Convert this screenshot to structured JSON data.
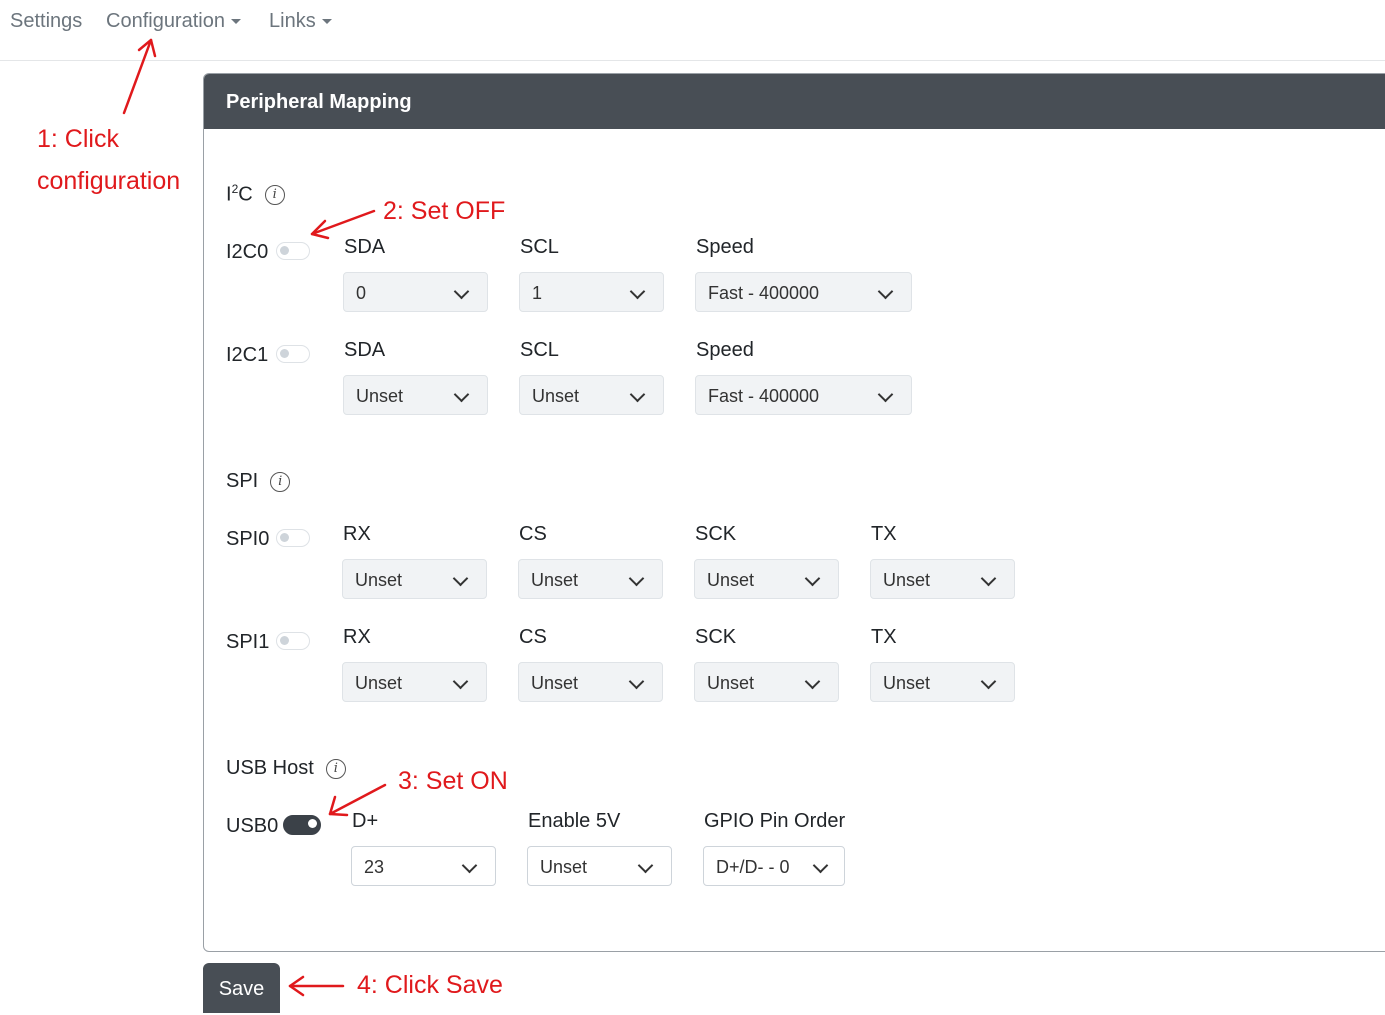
{
  "nav": {
    "settings": "Settings",
    "configuration": "Configuration",
    "links": "Links"
  },
  "card": {
    "title": "Peripheral Mapping"
  },
  "i2c": {
    "title_main": "I",
    "title_sup": "2",
    "title_end": "C",
    "rows": [
      {
        "label": "I2C0",
        "enabled": false,
        "fields": [
          {
            "label": "SDA",
            "value": "0"
          },
          {
            "label": "SCL",
            "value": "1"
          },
          {
            "label": "Speed",
            "value": "Fast - 400000"
          }
        ]
      },
      {
        "label": "I2C1",
        "enabled": false,
        "fields": [
          {
            "label": "SDA",
            "value": "Unset"
          },
          {
            "label": "SCL",
            "value": "Unset"
          },
          {
            "label": "Speed",
            "value": "Fast - 400000"
          }
        ]
      }
    ]
  },
  "spi": {
    "title": "SPI",
    "rows": [
      {
        "label": "SPI0",
        "enabled": false,
        "fields": [
          {
            "label": "RX",
            "value": "Unset"
          },
          {
            "label": "CS",
            "value": "Unset"
          },
          {
            "label": "SCK",
            "value": "Unset"
          },
          {
            "label": "TX",
            "value": "Unset"
          }
        ]
      },
      {
        "label": "SPI1",
        "enabled": false,
        "fields": [
          {
            "label": "RX",
            "value": "Unset"
          },
          {
            "label": "CS",
            "value": "Unset"
          },
          {
            "label": "SCK",
            "value": "Unset"
          },
          {
            "label": "TX",
            "value": "Unset"
          }
        ]
      }
    ]
  },
  "usb": {
    "title": "USB Host",
    "rows": [
      {
        "label": "USB0",
        "enabled": true,
        "fields": [
          {
            "label": "D+",
            "value": "23"
          },
          {
            "label": "Enable 5V",
            "value": "Unset"
          },
          {
            "label": "GPIO Pin Order",
            "value": "D+/D- - 0"
          }
        ]
      }
    ]
  },
  "info_icon_glyph": "i",
  "save_label": "Save",
  "annotations": {
    "step1_line1": "1:  Click",
    "step1_line2": "configuration",
    "step2": "2: Set OFF",
    "step3": "3: Set ON",
    "step4": "4: Click Save"
  },
  "colors": {
    "header_bg": "#484e55",
    "annotation_red": "#e0191c",
    "switch_on": "#3b4148"
  }
}
